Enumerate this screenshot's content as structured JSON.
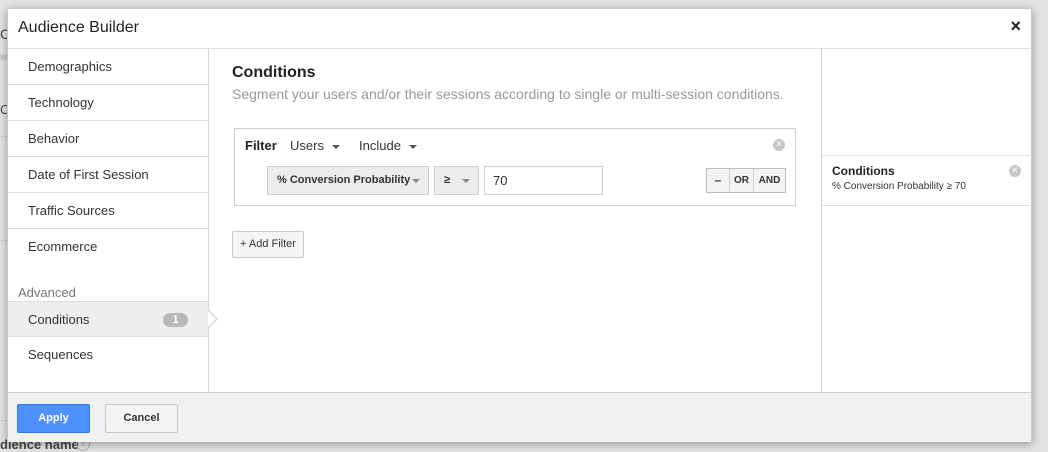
{
  "background": {
    "audience_name_label": "dience name",
    "help_icon": "?",
    "fragment_c": "C",
    "fragment_w": "w",
    "fragment_q": "C"
  },
  "dialog": {
    "title": "Audience Builder",
    "close_icon": "×"
  },
  "sidebar": {
    "items": [
      {
        "label": "Demographics"
      },
      {
        "label": "Technology"
      },
      {
        "label": "Behavior"
      },
      {
        "label": "Date of First Session"
      },
      {
        "label": "Traffic Sources"
      },
      {
        "label": "Ecommerce"
      }
    ],
    "section_label": "Advanced",
    "advanced_items": [
      {
        "label": "Conditions",
        "badge": "1",
        "active": true
      },
      {
        "label": "Sequences"
      }
    ]
  },
  "main": {
    "title": "Conditions",
    "subtitle": "Segment your users and/or their sessions according to single or multi-session conditions.",
    "filter": {
      "label": "Filter",
      "scope": "Users",
      "mode": "Include",
      "remove_icon": "×",
      "dimension": "% Conversion Probability",
      "operator": "≥",
      "value": "70",
      "buttons": {
        "minus": "–",
        "or": "OR",
        "and": "AND"
      }
    },
    "add_filter": "+ Add Filter"
  },
  "summary": {
    "title": "Conditions",
    "description": "% Conversion Probability ≥ 70",
    "remove_icon": "×"
  },
  "footer": {
    "apply": "Apply",
    "cancel": "Cancel"
  },
  "colors": {
    "primary_button": "#4d90fe",
    "badge": "#b8b8b8"
  }
}
